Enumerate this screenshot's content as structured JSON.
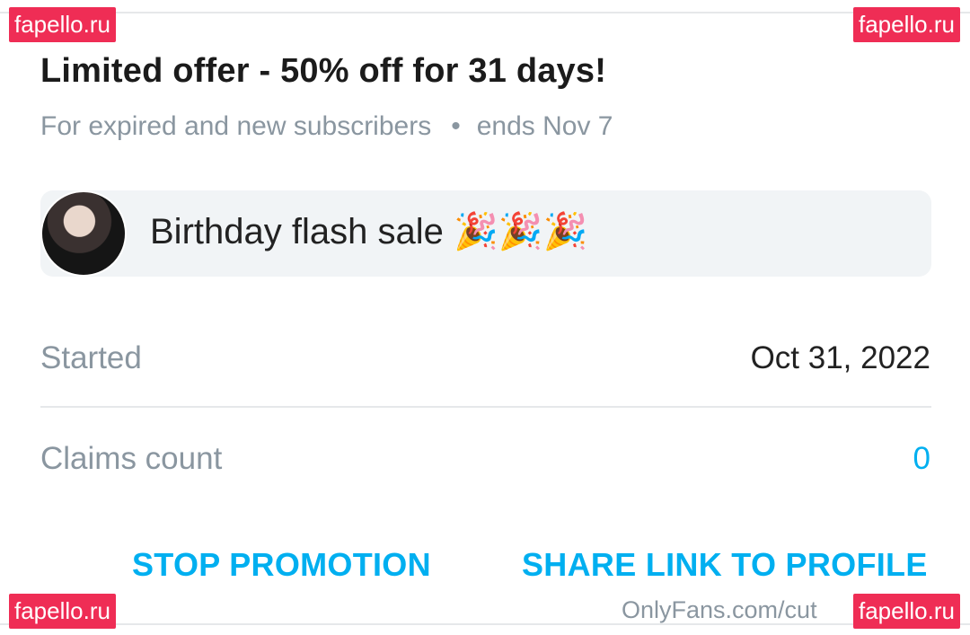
{
  "offer": {
    "title": "Limited offer - 50% off for 31 days!",
    "audience": "For expired and new subscribers",
    "separator": "•",
    "ends": "ends Nov 7"
  },
  "message": {
    "text": "Birthday flash sale 🎉🎉🎉"
  },
  "details": {
    "started_label": "Started",
    "started_value": "Oct 31, 2022",
    "claims_label": "Claims count",
    "claims_value": "0"
  },
  "actions": {
    "stop_label": "STOP PROMOTION",
    "share_label": "SHARE LINK TO PROFILE"
  },
  "watermarks": {
    "text": "fapello.ru"
  },
  "footer": {
    "url": "OnlyFans.com/cut"
  },
  "colors": {
    "accent": "#00aff0",
    "watermark": "#ef2d55"
  }
}
